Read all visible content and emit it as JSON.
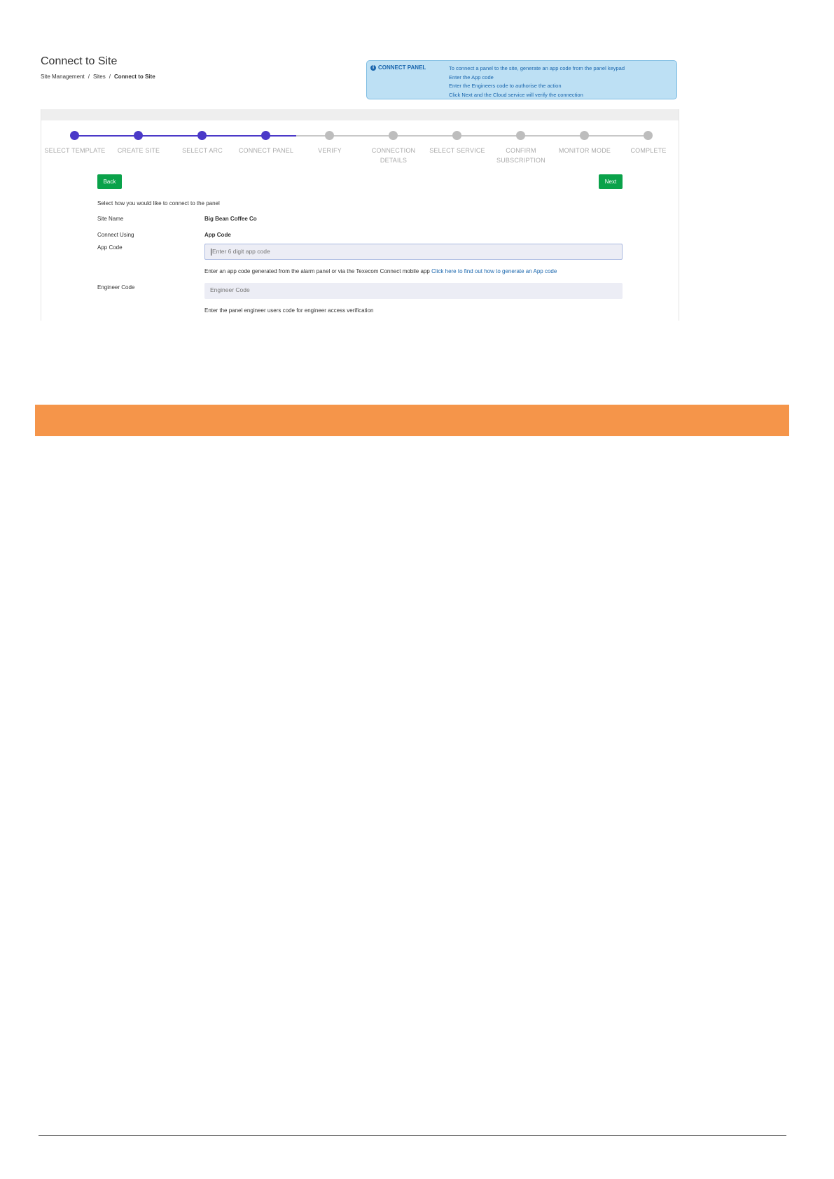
{
  "header": {
    "title": "Connect to Site",
    "breadcrumb": [
      "Site Management",
      "Sites",
      "Connect to Site"
    ],
    "breadcrumb_sep": "/"
  },
  "info_panel": {
    "title": "CONNECT PANEL",
    "lines": [
      "To connect a panel to the site, generate an app code from the panel keypad",
      "Enter the App code",
      "Enter the Engineers code to authorise the action",
      "Click Next and the Cloud service will verify the connection"
    ],
    "color": "#1a66ad"
  },
  "stepper": {
    "completed_color": "#4b39c8",
    "pending_color": "#bdbdbd",
    "steps": [
      {
        "label": "SELECT TEMPLATE",
        "done": true
      },
      {
        "label": "CREATE SITE",
        "done": true
      },
      {
        "label": "SELECT ARC",
        "done": true
      },
      {
        "label": "CONNECT PANEL",
        "done": true
      },
      {
        "label": "VERIFY",
        "done": false
      },
      {
        "label": "CONNECTION DETAILS",
        "done": false
      },
      {
        "label": "SELECT SERVICE",
        "done": false
      },
      {
        "label": "CONFIRM SUBSCRIPTION",
        "done": false
      },
      {
        "label": "MONITOR MODE",
        "done": false
      },
      {
        "label": "COMPLETE",
        "done": false
      }
    ]
  },
  "buttons": {
    "back": "Back",
    "next": "Next",
    "color": "#0aa24a"
  },
  "form": {
    "intro": "Select how you would like to connect to the panel",
    "site_name_label": "Site Name",
    "site_name_value": "Big Bean Coffee Co",
    "connect_using_label": "Connect Using",
    "connect_using_value": "App Code",
    "app_code_label": "App Code",
    "app_code_placeholder": "Enter 6 digit app code",
    "app_code_help": "Enter an app code generated from the alarm panel or via the Texecom Connect mobile app",
    "app_code_help_link": "Click here to find out how to generate an App code",
    "engineer_code_label": "Engineer Code",
    "engineer_code_placeholder": "Engineer Code",
    "engineer_code_help": "Enter the panel engineer users code for engineer access verification"
  },
  "accent_color": "#f5954a"
}
